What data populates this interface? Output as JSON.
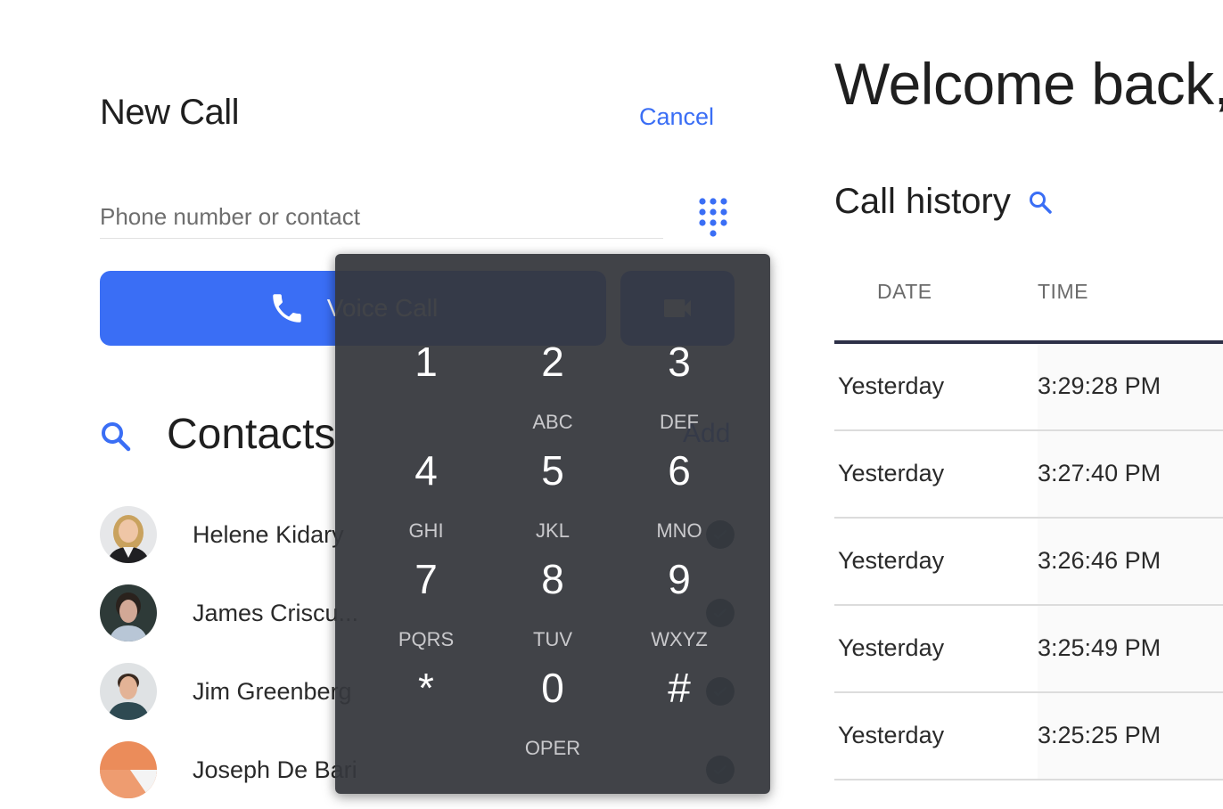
{
  "new_call": {
    "title": "New Call",
    "cancel_label": "Cancel",
    "phone_placeholder": "Phone number or contact",
    "phone_value": "",
    "keypad_icon": "dialpad-icon",
    "voice_call_label": "Voice Call",
    "voice_call_icon": "phone-icon",
    "video_call_icon": "video-camera-icon"
  },
  "contacts": {
    "title": "Contacts",
    "add_label": "Add",
    "search_icon": "search-icon",
    "items": [
      {
        "name": "Helene Kidary",
        "selected": true
      },
      {
        "name": "James Criscu...",
        "selected": true
      },
      {
        "name": "Jim Greenberg",
        "selected": true
      },
      {
        "name": "Joseph De Bari",
        "selected": true
      }
    ]
  },
  "welcome": {
    "title": "Welcome back,"
  },
  "call_history": {
    "title": "Call history",
    "search_icon": "search-icon",
    "columns": [
      "DATE",
      "TIME"
    ],
    "rows": [
      {
        "date": "Yesterday",
        "time": "3:29:28 PM"
      },
      {
        "date": "Yesterday",
        "time": "3:27:40 PM"
      },
      {
        "date": "Yesterday",
        "time": "3:26:46 PM"
      },
      {
        "date": "Yesterday",
        "time": "3:25:49 PM"
      },
      {
        "date": "Yesterday",
        "time": "3:25:25 PM"
      }
    ]
  },
  "dialpad": {
    "keys": [
      {
        "digit": "1",
        "letters": ""
      },
      {
        "digit": "2",
        "letters": "ABC"
      },
      {
        "digit": "3",
        "letters": "DEF"
      },
      {
        "digit": "4",
        "letters": "GHI"
      },
      {
        "digit": "5",
        "letters": "JKL"
      },
      {
        "digit": "6",
        "letters": "MNO"
      },
      {
        "digit": "7",
        "letters": "PQRS"
      },
      {
        "digit": "8",
        "letters": "TUV"
      },
      {
        "digit": "9",
        "letters": "WXYZ"
      },
      {
        "digit": "*",
        "letters": ""
      },
      {
        "digit": "0",
        "letters": "OPER"
      },
      {
        "digit": "#",
        "letters": ""
      }
    ]
  },
  "colors": {
    "accent": "#3a6ef5",
    "dialpad_bg": "#3f4046",
    "table_header_rule": "#2d3047",
    "check_badge": "#24485a"
  }
}
